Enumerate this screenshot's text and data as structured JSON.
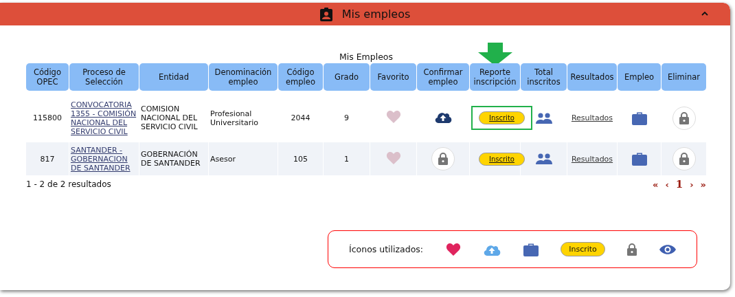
{
  "panel": {
    "title": "Mis empleos",
    "expanded": true
  },
  "table": {
    "caption": "Mis Empleos",
    "pointer_arrow": true,
    "columns": [
      "Código OPEC",
      "Proceso de Selección",
      "Entidad",
      "Denominación empleo",
      "Código empleo",
      "Grado",
      "Favorito",
      "Confirmar empleo",
      "Reporte inscripción",
      "Total inscritos",
      "Resultados",
      "Empleo",
      "Eliminar"
    ],
    "rows": [
      {
        "opec": "115800",
        "proceso": "CONVOCATORIA 1355 - COMISIÓN NACIONAL DEL SERVICIO CIVIL",
        "entidad": "COMISION NACIONAL DEL SERVICIO CIVIL",
        "denominacion": "Profesional Universitario",
        "codigo": "2044",
        "grado": "9",
        "favorite": false,
        "confirm": {
          "kind": "upload"
        },
        "report": "Inscrito",
        "report_highlighted": true,
        "results": "Resultados"
      },
      {
        "opec": "817",
        "proceso": "SANTANDER - GOBERNACION DE SANTANDER",
        "entidad": "GOBERNACIÓN DE SANTANDER",
        "denominacion": "Asesor",
        "codigo": "105",
        "grado": "1",
        "favorite": false,
        "confirm": {
          "kind": "locked"
        },
        "report": "Inscrito",
        "report_highlighted": false,
        "results": "Resultados"
      }
    ],
    "summary": "1 - 2 de 2 resultados",
    "pagination": [
      {
        "label": "«",
        "selected": false
      },
      {
        "label": "‹",
        "selected": false
      },
      {
        "label": "1",
        "selected": true
      },
      {
        "label": "›",
        "selected": false
      },
      {
        "label": "»",
        "selected": false
      }
    ]
  },
  "legend": {
    "label": "Íconos utilizados:",
    "items": [
      {
        "kind": "heart"
      },
      {
        "kind": "upload"
      },
      {
        "kind": "briefcase"
      },
      {
        "kind": "badge",
        "text": "Inscrito"
      },
      {
        "kind": "lock"
      },
      {
        "kind": "eye"
      }
    ]
  }
}
